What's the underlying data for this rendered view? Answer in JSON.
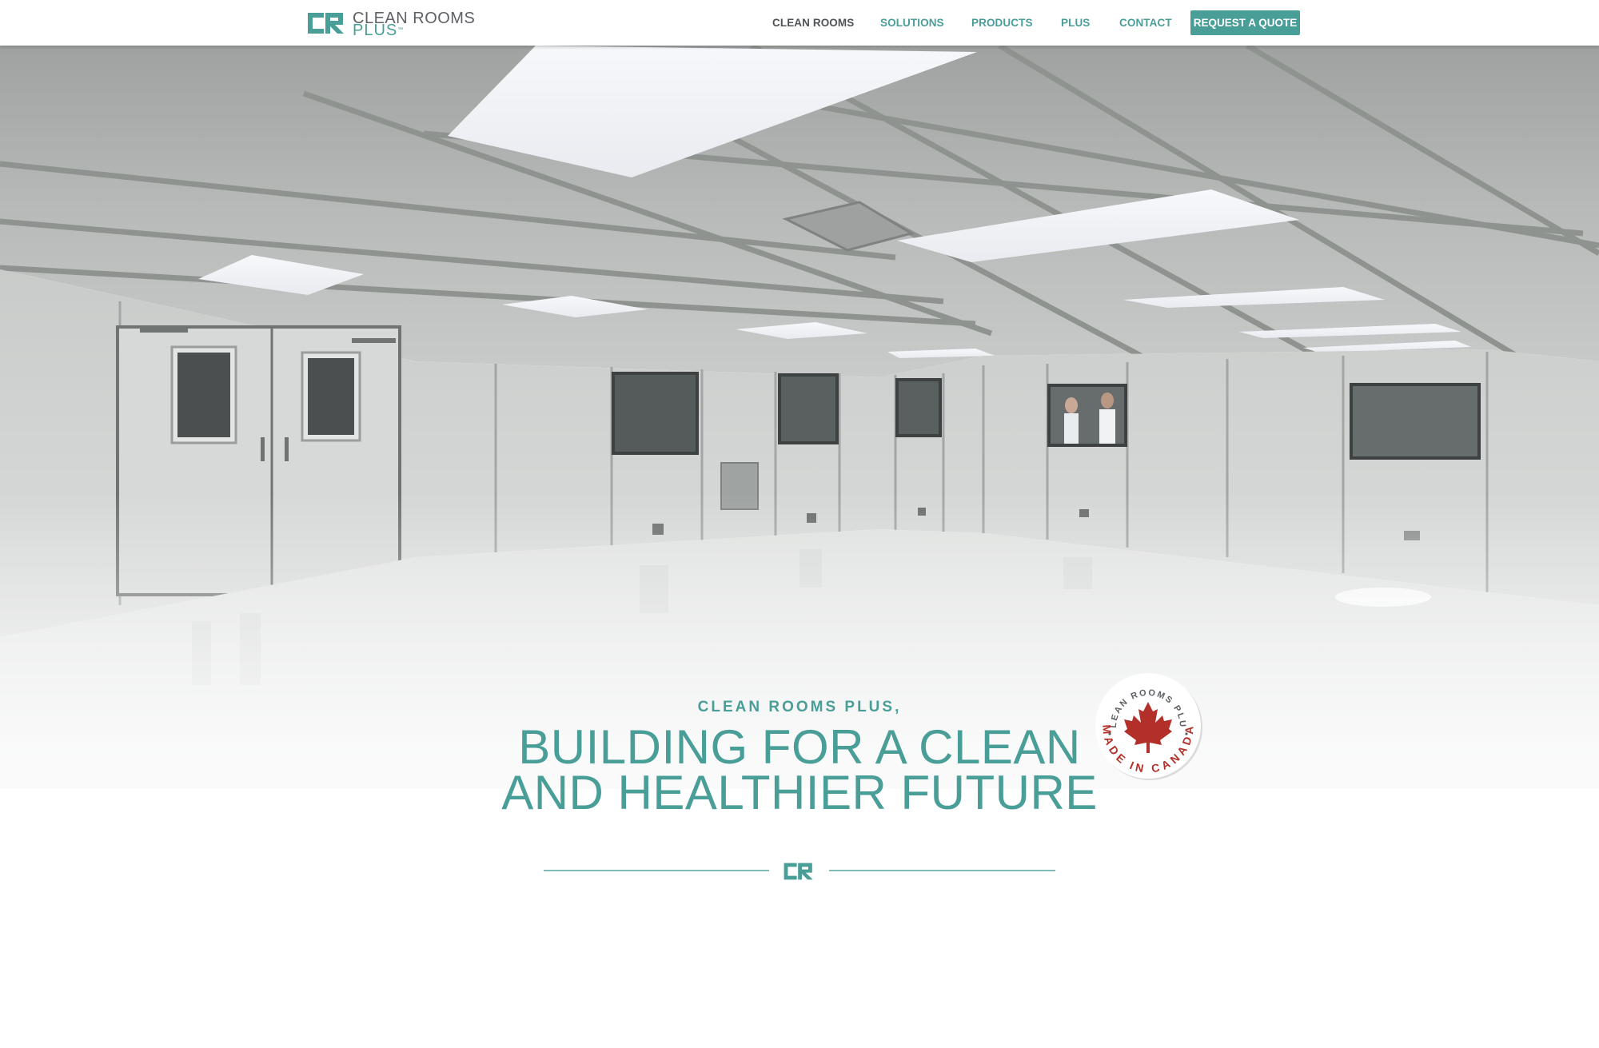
{
  "header": {
    "logo": {
      "line1": "CLEAN ROOMS",
      "line2": "PLUS",
      "trademark": "™",
      "icon": "cr-monogram-icon"
    },
    "nav": [
      {
        "label": "CLEAN ROOMS",
        "active": true
      },
      {
        "label": "SOLUTIONS"
      },
      {
        "label": "PRODUCTS"
      },
      {
        "label": "PLUS"
      },
      {
        "label": "CONTACT"
      }
    ],
    "cta_label": "REQUEST A QUOTE"
  },
  "hero": {
    "eyebrow": "CLEAN ROOMS PLUS,",
    "headline_line1": "BUILDING FOR A CLEAN",
    "headline_line2": "AND HEALTHIER FUTURE",
    "badge": {
      "top_text": "CLEAN ROOMS PLUS",
      "bottom_text": "MADE IN CANADA",
      "icon": "maple-leaf-icon"
    },
    "divider_icon": "cr-monogram-icon"
  },
  "colors": {
    "brand_teal": "#4a9e98",
    "nav_dark": "#4f5356",
    "badge_red": "#b3302a"
  }
}
